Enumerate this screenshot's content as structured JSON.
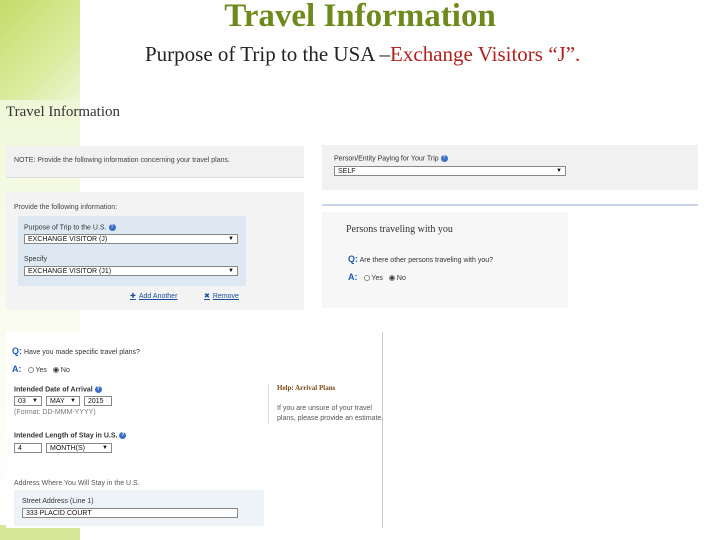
{
  "slide": {
    "title": "Travel Information",
    "subtitle_prefix": "Purpose of Trip to the USA –",
    "subtitle_em": "Exchange Visitors “J”."
  },
  "form": {
    "heading": "Travel Information",
    "note": "NOTE: Provide the following information concerning your travel plans.",
    "provide_label": "Provide the following information:",
    "purpose_label": "Purpose of Trip to the U.S.",
    "purpose_value": "EXCHANGE VISITOR (J)",
    "specify_label": "Specify",
    "specify_value": "EXCHANGE VISITOR (J1)",
    "add_another": "Add Another",
    "remove": "Remove",
    "travel_plans_q": "Have you made specific travel plans?",
    "answer_prefix": "A:",
    "yes": "Yes",
    "no": "No",
    "arrival_label": "Intended Date of Arrival",
    "arrival_day": "03",
    "arrival_month": "MAY",
    "arrival_year": "2015",
    "format_hint": "(Format: DD-MMM-YYYY)",
    "stay_label": "Intended Length of Stay in U.S.",
    "stay_value": "4",
    "stay_unit": "MONTH(S)",
    "address_label": "Address Where You Will Stay in the U.S.",
    "street_label": "Street Address (Line 1)",
    "street_value": "333 PLACID COURT",
    "help_title": "Help: Arrival Plans",
    "help_text": "If you are unsure of your travel plans, please provide an estimate."
  },
  "right": {
    "paying_label": "Person/Entity Paying for Your Trip",
    "paying_value": "SELF",
    "persons_title": "Persons traveling with you",
    "persons_q": "Are there other persons traveling with you?",
    "answer_prefix": "A:",
    "yes": "Yes",
    "no": "No"
  },
  "colors": {
    "title_green": "#6d8a1c",
    "em_red": "#b11f1f",
    "link_blue": "#1a4d99"
  }
}
